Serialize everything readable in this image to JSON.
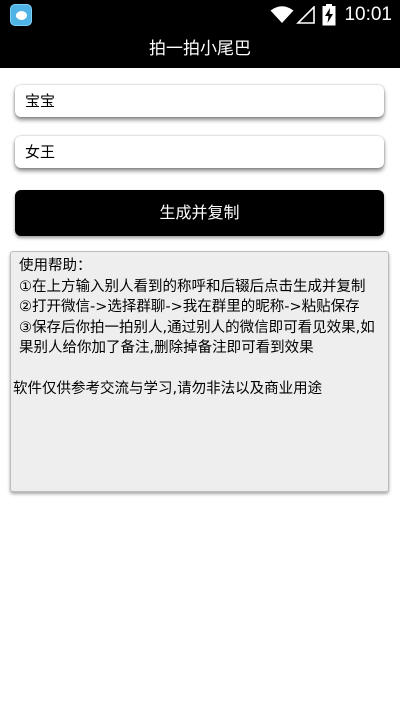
{
  "status_bar": {
    "time": "10:01",
    "icons": [
      "app-icon",
      "wifi-icon",
      "no-signal-icon",
      "battery-charging-icon"
    ]
  },
  "title": "拍一拍小尾巴",
  "inputs": {
    "nickname_value": "宝宝",
    "suffix_value": "女王"
  },
  "generate_button": "生成并复制",
  "help": {
    "heading": "使用帮助：",
    "step1": "①在上方输入别人看到的称呼和后辍后点击生成并复制",
    "step2": "②打开微信->选择群聊->我在群里的昵称->粘贴保存",
    "step3": "③保存后你拍一拍别人,通过别人的微信即可看见效果,如果别人给你加了备注,删除掉备注即可看到效果",
    "disclaimer": "软件仅供参考交流与学习,请勿非法以及商业用途"
  },
  "colors": {
    "bar_background": "#000000",
    "help_background": "#eeeeee",
    "app_icon": "#4fb3e6"
  }
}
